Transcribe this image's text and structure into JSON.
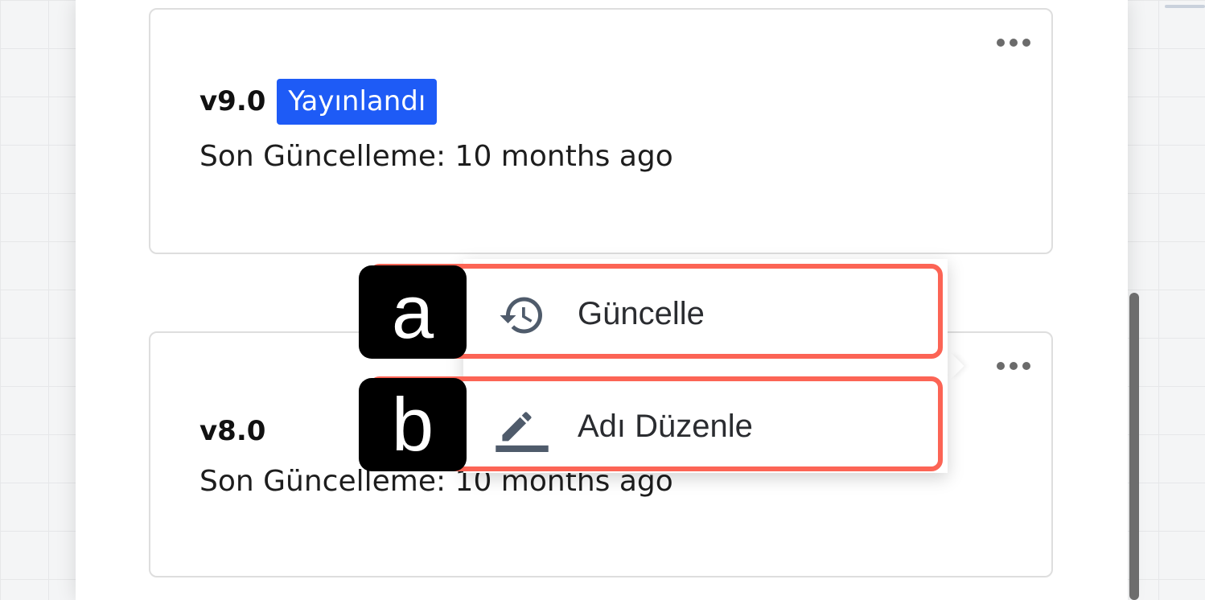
{
  "cards": [
    {
      "version": "v9.0",
      "badge": "Yayınlandı",
      "updated": "Son Güncelleme: 10 months ago"
    },
    {
      "version": "v8.0",
      "badge": "",
      "updated": "Son Güncelleme: 10 months ago"
    }
  ],
  "menu": {
    "items": [
      {
        "marker": "a",
        "label": "Güncelle",
        "icon": "history-icon"
      },
      {
        "marker": "b",
        "label": "Adı Düzenle",
        "icon": "edit-pencil-icon"
      }
    ]
  },
  "colors": {
    "badge_bg": "#1e5bf6",
    "highlight_border": "#fc6455",
    "icon_color": "#4f5b6b"
  }
}
